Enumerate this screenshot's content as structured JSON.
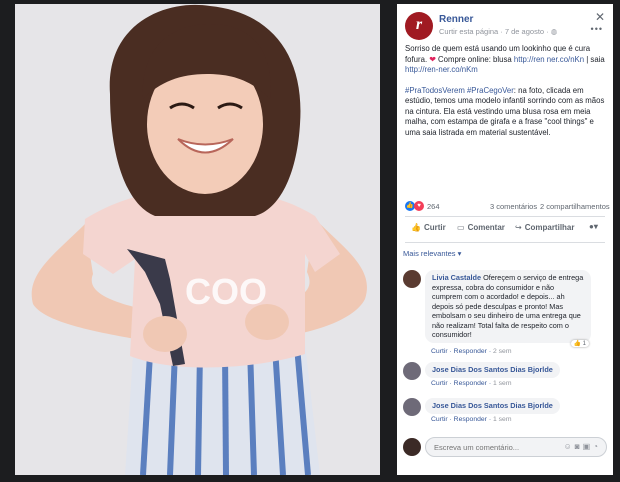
{
  "post": {
    "page_name": "Renner",
    "logo_letter": "r",
    "meta_like": "Curtir esta página",
    "meta_date": "7 de agosto",
    "caption": "Sorriso de quem está usando um lookinho que é cura fofura.",
    "shop_text": "Compre online: blusa",
    "shop_link_1": "http://ren ner.co/nKn",
    "shop_sep": " | saia ",
    "shop_link_2": "http://ren-ner.co/nKm",
    "hashtags": "#PraTodosVerem #PraCegoVer",
    "description": ": na foto, clicada em estúdio, temos uma modelo infantil sorrindo com as mãos na cintura. Ela está vestindo uma blusa rosa em meia malha, com estampa de girafa e a frase \"cool things\" e uma saia listrada em material sustentável.",
    "reactions": "264",
    "comments_count": "3 comentários",
    "shares_count": "2 compartilhamentos"
  },
  "actions": {
    "like": "Curtir",
    "comment": "Comentar",
    "share": "Compartilhar"
  },
  "filter_label": "Mais relevantes ▾",
  "comments": [
    {
      "author": "Livia Castalde",
      "text": "Ofereçem o serviço de entrega expressa, cobra do consumidor e não cumprem com o acordado! e depois... ah depois só pede desculpas e pronto! Mas embolsam o seu dinheiro de uma entrega que não realizam! Total falta de respeito com o consumidor!",
      "like": "Curtir",
      "reply": "Responder",
      "time": "2 sem",
      "reaction_count": "1"
    },
    {
      "author": "Jose Dias Dos Santos Dias Bjorlde",
      "text": "",
      "like": "Curtir",
      "reply": "Responder",
      "time": "1 sem"
    },
    {
      "author": "Jose Dias Dos Santos Dias Bjorlde",
      "text": "",
      "like": "Curtir",
      "reply": "Responder",
      "time": "1 sem"
    }
  ],
  "composer": {
    "placeholder": "Escreva um comentário..."
  },
  "icons": {
    "close": "close-icon",
    "more": "more-icon",
    "like": "thumbs-up-icon",
    "comment": "speech-bubble-icon",
    "share": "share-arrow-icon",
    "emoji": "emoji-icon",
    "camera": "camera-icon",
    "gif": "gif-icon",
    "sticker": "sticker-icon"
  },
  "colors": {
    "link": "#385898",
    "brand": "#a01a22",
    "heart": "#e0245e",
    "like_blue": "#1877f2",
    "shirt": "#f4d5d0",
    "skirt_stripe": "#5b7fbf"
  }
}
